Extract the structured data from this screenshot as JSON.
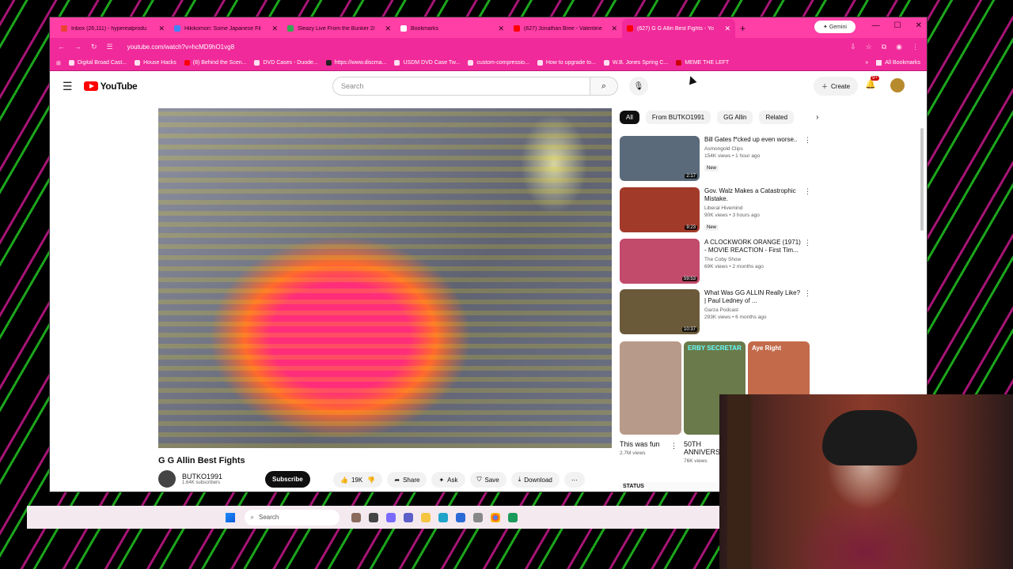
{
  "browser": {
    "tabs": [
      {
        "title": "Inbox (26,111) - hyperealprodu",
        "color": "#ea4335"
      },
      {
        "title": "Hikikomori: Some Japanese Fil",
        "color": "#4285f4"
      },
      {
        "title": "Sleazy Live From the Bunker 2/",
        "color": "#34a853"
      },
      {
        "title": "Bookmarks",
        "color": "#ffffff"
      },
      {
        "title": "(627) Jonathan Bree - Valentine",
        "color": "#ff0000"
      },
      {
        "title": "(627) G G Allin Best Fights - Yo",
        "color": "#ff0000"
      }
    ],
    "new_tab": "+",
    "gemini": "Gemini",
    "url": "youtube.com/watch?v=hcMD9hO1vg8",
    "bookmarks": [
      "Digital Broad Cast...",
      "House Hacks",
      "(8) Behind the Scen...",
      "DVD Cases - Duode...",
      "https://www.discma...",
      "USDM DVD Case Tw...",
      "custom-compressio...",
      "How to upgrade to...",
      "W.B. Jones Spring C...",
      "MEME THE LEFT"
    ],
    "all_bookmarks": "All Bookmarks"
  },
  "youtube": {
    "logo_text": "YouTube",
    "search_placeholder": "Search",
    "create_label": "Create",
    "notif_count": "9+",
    "video_title": "G G Allin Best Fights",
    "channel_name": "BUTKO1991",
    "channel_subs": "1.64K subscribers",
    "subscribe_label": "Subscribe",
    "actions": {
      "likes": "19K",
      "share": "Share",
      "ask": "Ask",
      "save": "Save",
      "download": "Download"
    },
    "chips": [
      "All",
      "From BUTKO1991",
      "GG Allin",
      "Related"
    ],
    "recommendations": [
      {
        "title": "Bill Gates f*cked up even worse..",
        "channel": "Asmongold Clips",
        "meta": "154K views • 1 hour ago",
        "badge": "New",
        "duration": "2:17",
        "thumb_color": "#5a6a7a"
      },
      {
        "title": "Gov. Walz Makes a Catastrophic Mistake.",
        "channel": "Liberal Hivemind",
        "meta": "90K views • 3 hours ago",
        "badge": "New",
        "duration": "9:23",
        "thumb_color": "#a23a2a"
      },
      {
        "title": "A CLOCKWORK ORANGE (1971) - MOVIE REACTION - First Tim...",
        "channel": "The Coby Show",
        "meta": "69K views • 2 months ago",
        "badge": "",
        "duration": "59:53",
        "thumb_color": "#c24a6a"
      },
      {
        "title": "What Was GG ALLIN Really Like? | Paul Ledney of ...",
        "channel": "Garza Podcast",
        "meta": "293K views • 6 months ago",
        "badge": "",
        "duration": "10:37",
        "thumb_color": "#6a5a3a"
      }
    ],
    "shorts": [
      {
        "title": "This was fun",
        "views": "2.7M views",
        "label": "",
        "color": "#b89a8a"
      },
      {
        "title": "50TH ANNIVERS",
        "views": "76K views",
        "label": "ERBY SECRETAR",
        "color": "#6a7a4a"
      },
      {
        "title": "",
        "views": "",
        "label": "Aye Right",
        "color": "#c26a4a"
      }
    ],
    "peek_label": "STATUS"
  },
  "taskbar": {
    "search_placeholder": "Search"
  }
}
